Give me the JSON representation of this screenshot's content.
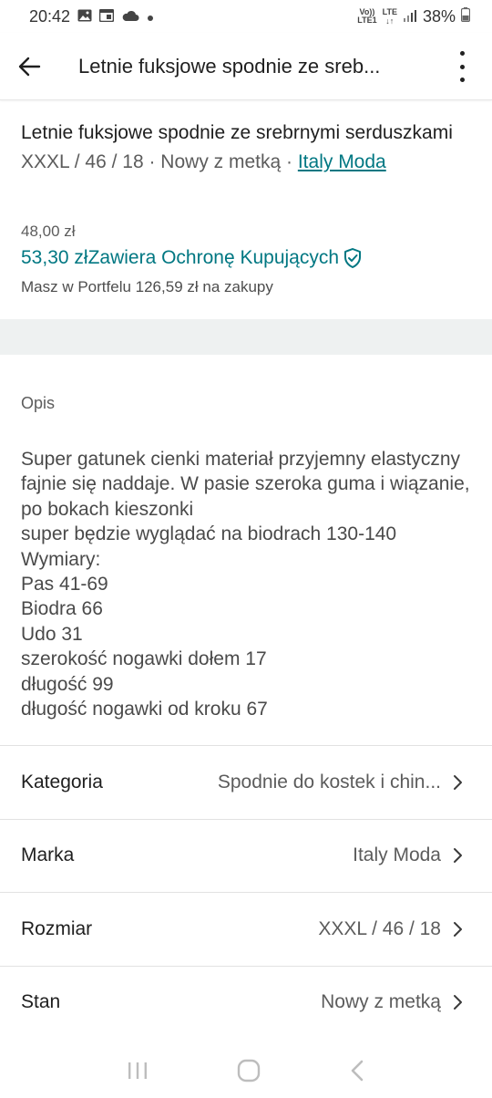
{
  "status_bar": {
    "time": "20:42",
    "volte_top": "Vo))",
    "volte_bottom": "LTE1",
    "network": "LTE",
    "battery": "38%"
  },
  "header": {
    "title": "Letnie fuksjowe spodnie ze sreb..."
  },
  "item": {
    "title": "Letnie fuksjowe spodnie ze srebrnymi serduszkami",
    "meta_prefix": "XXXL / 46 / 18 · Nowy z metką · ",
    "brand": "Italy Moda",
    "price": "48,00 zł",
    "price_with_protection": "53,30 zł",
    "protection_label": "Zawiera Ochronę Kupujących",
    "wallet_note": "Masz w Portfelu 126,59 zł na zakupy"
  },
  "description": {
    "label": "Opis",
    "text": "Super gatunek cienki materiał przyjemny elastyczny fajnie się naddaje. W pasie szeroka guma i wiązanie, po bokach kieszonki\nsuper będzie wyglądać na biodrach 130-140\nWymiary:\nPas 41-69\nBiodra 66\nUdo 31\nszerokość nogawki dołem 17\ndługość 99\ndługość nogawki od kroku 67"
  },
  "attributes": [
    {
      "label": "Kategoria",
      "value": "Spodnie do kostek i chin..."
    },
    {
      "label": "Marka",
      "value": "Italy Moda"
    },
    {
      "label": "Rozmiar",
      "value": "XXXL / 46 / 18"
    },
    {
      "label": "Stan",
      "value": "Nowy z metką"
    }
  ],
  "colors": {
    "accent": "#007782",
    "band": "#eef1f1"
  },
  "icons": {
    "back": "arrow-left-icon",
    "more": "more-vertical-icon",
    "shield": "shield-check-icon",
    "chevron": "chevron-right-icon"
  }
}
